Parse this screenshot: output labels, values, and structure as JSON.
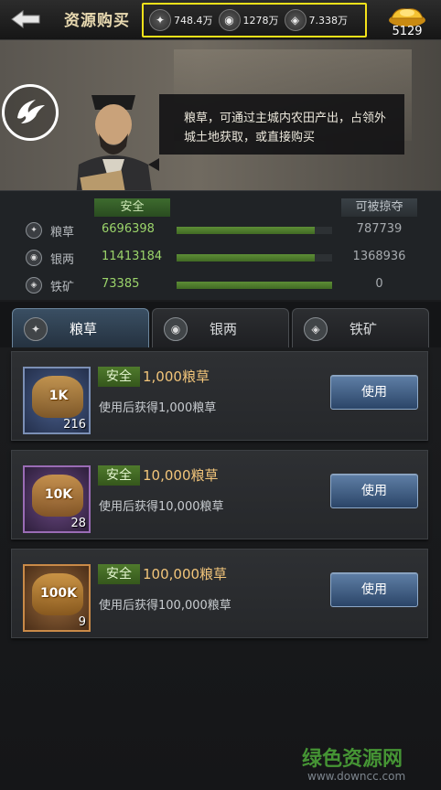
{
  "header": {
    "title": "资源购买",
    "resources": [
      {
        "icon": "grain-icon",
        "value": "748.4万"
      },
      {
        "icon": "silver-icon",
        "value": "1278万"
      },
      {
        "icon": "iron-icon",
        "value": "7.338万"
      }
    ],
    "gold": {
      "icon": "gold-ingot-icon",
      "value": "5129"
    }
  },
  "banner": {
    "tip": "粮草，可通过主城内农田产出，占领外城土地获取，或直接购买"
  },
  "stats": {
    "safe_header": "安全",
    "loot_header": "可被掠夺",
    "rows": [
      {
        "name": "粮草",
        "safe": "6696398",
        "loot": "787739",
        "safe_fraction": 0.89
      },
      {
        "name": "银两",
        "safe": "11413184",
        "loot": "1368936",
        "safe_fraction": 0.89
      },
      {
        "name": "铁矿",
        "safe": "73385",
        "loot": "0",
        "safe_fraction": 1.0
      }
    ]
  },
  "tabs": [
    {
      "label": "粮草",
      "active": true
    },
    {
      "label": "银两",
      "active": false
    },
    {
      "label": "铁矿",
      "active": false
    }
  ],
  "items": [
    {
      "tag": "1K",
      "count": "216",
      "badge": "安全",
      "name": "1,000粮草",
      "desc": "使用后获得1,000粮草",
      "button": "使用"
    },
    {
      "tag": "10K",
      "count": "28",
      "badge": "安全",
      "name": "10,000粮草",
      "desc": "使用后获得10,000粮草",
      "button": "使用"
    },
    {
      "tag": "100K",
      "count": "9",
      "badge": "安全",
      "name": "100,000粮草",
      "desc": "使用后获得100,000粮草",
      "button": "使用"
    }
  ],
  "watermark": {
    "name": "绿色资源网",
    "url": "www.downcc.com"
  }
}
